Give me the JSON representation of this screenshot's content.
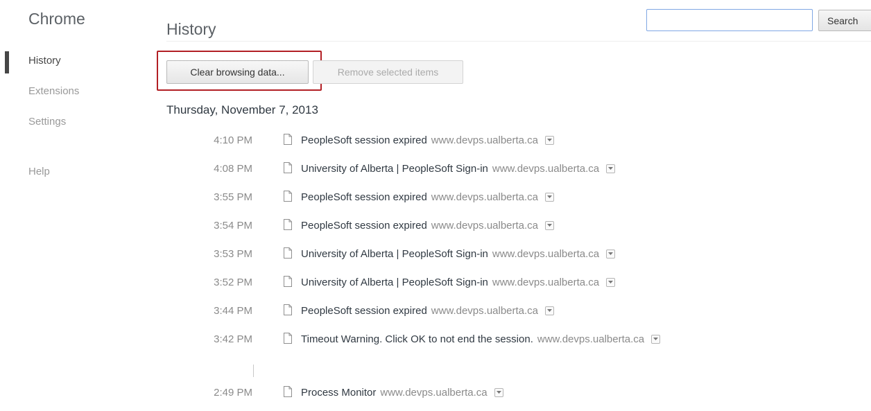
{
  "sidebar": {
    "brand": "Chrome",
    "items": [
      {
        "label": "History",
        "selected": true
      },
      {
        "label": "Extensions",
        "selected": false
      },
      {
        "label": "Settings",
        "selected": false
      },
      {
        "label": "Help",
        "selected": false
      }
    ]
  },
  "header": {
    "title": "History",
    "search_placeholder": "",
    "search_button": "Search"
  },
  "toolbar": {
    "clear_label": "Clear browsing data...",
    "remove_label": "Remove selected items"
  },
  "history": {
    "day": "Thursday, November 7, 2013",
    "entries": [
      {
        "time": "4:10 PM",
        "title": "PeopleSoft session expired",
        "domain": "www.devps.ualberta.ca"
      },
      {
        "time": "4:08 PM",
        "title": "University of Alberta | PeopleSoft Sign-in",
        "domain": "www.devps.ualberta.ca"
      },
      {
        "time": "3:55 PM",
        "title": "PeopleSoft session expired",
        "domain": "www.devps.ualberta.ca"
      },
      {
        "time": "3:54 PM",
        "title": "PeopleSoft session expired",
        "domain": "www.devps.ualberta.ca"
      },
      {
        "time": "3:53 PM",
        "title": "University of Alberta | PeopleSoft Sign-in",
        "domain": "www.devps.ualberta.ca"
      },
      {
        "time": "3:52 PM",
        "title": "University of Alberta | PeopleSoft Sign-in",
        "domain": "www.devps.ualberta.ca"
      },
      {
        "time": "3:44 PM",
        "title": "PeopleSoft session expired",
        "domain": "www.devps.ualberta.ca"
      },
      {
        "time": "3:42 PM",
        "title": "Timeout Warning. Click OK to not end the session.",
        "domain": "www.devps.ualberta.ca"
      },
      {
        "time": "2:49 PM",
        "title": "Process Monitor",
        "domain": "www.devps.ualberta.ca"
      }
    ]
  },
  "colors": {
    "highlight": "#b21f24",
    "search_border": "#7fa7e4",
    "nav_selected": "#464646"
  }
}
